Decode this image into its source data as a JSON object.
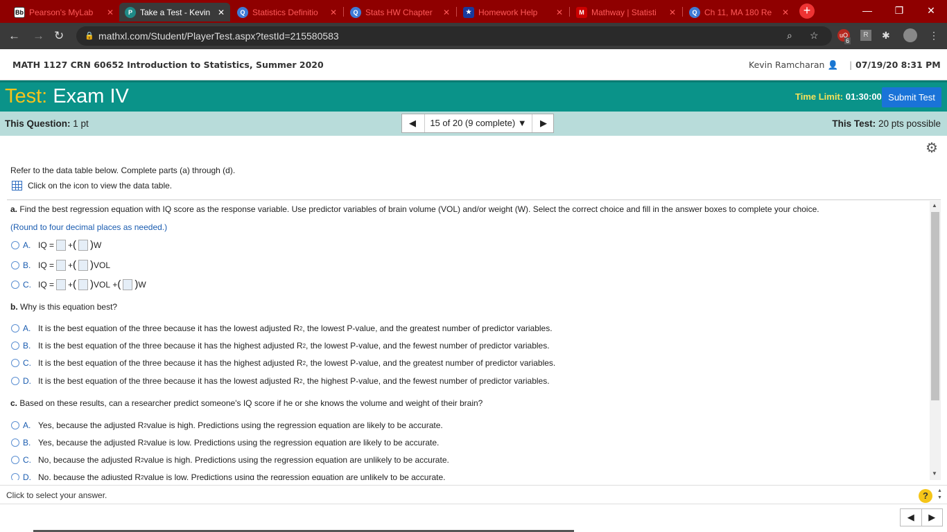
{
  "browser": {
    "tabs": [
      {
        "title": "Pearson's MyLab",
        "icon": "Bb",
        "active": false
      },
      {
        "title": "Take a Test - Kevin",
        "icon": "P",
        "active": true
      },
      {
        "title": "Statistics Definitio",
        "icon": "Q",
        "active": false
      },
      {
        "title": "Stats HW Chapter",
        "icon": "Q",
        "active": false
      },
      {
        "title": "Homework Help",
        "icon": "★",
        "active": false
      },
      {
        "title": "Mathway | Statisti",
        "icon": "M",
        "active": false
      },
      {
        "title": "Ch 11, MA 180 Re",
        "icon": "Q",
        "active": false
      }
    ],
    "url": "mathxl.com/Student/PlayerTest.aspx?testId=215580583",
    "ext_badge": "6"
  },
  "header": {
    "course": "MATH 1127 CRN 60652 Introduction to Statistics, Summer 2020",
    "user": "Kevin Ramcharan",
    "datetime": "07/19/20 8:31 PM"
  },
  "testbar": {
    "label": "Test:",
    "name": "Exam IV",
    "time_limit_label": "Time Limit:",
    "time_limit": "01:30:00",
    "submit": "Submit Test"
  },
  "qbar": {
    "question_label": "This Question:",
    "question_pts": "1 pt",
    "progress": "15 of 20 (9 complete)",
    "test_label": "This Test:",
    "test_pts": "20 pts possible"
  },
  "question": {
    "intro": "Refer to the data table below. Complete parts (a) through (d).",
    "table_link": "Click on the icon to view the data table.",
    "part_a_label": "a.",
    "part_a": "Find the best regression equation with IQ score as the response variable. Use predictor variables of brain volume (VOL) and/or weight (W). Select the correct choice and fill in the answer boxes to complete your choice.",
    "round_hint": "(Round to four decimal places as needed.)",
    "part_a_options": [
      {
        "letter": "A.",
        "lhs": "IQ =",
        "terms": [
          "W"
        ]
      },
      {
        "letter": "B.",
        "lhs": "IQ =",
        "terms": [
          "VOL"
        ]
      },
      {
        "letter": "C.",
        "lhs": "IQ =",
        "terms": [
          "VOL",
          "W"
        ]
      }
    ],
    "part_b_label": "b.",
    "part_b": "Why is this equation best?",
    "part_b_options": [
      {
        "letter": "A.",
        "pre": "It is the best equation of the three because it has the lowest adjusted R",
        "post": ", the lowest P-value, and the greatest number of predictor variables."
      },
      {
        "letter": "B.",
        "pre": "It is the best equation of the three because it has the highest adjusted R",
        "post": ", the lowest P-value, and the fewest number of predictor variables."
      },
      {
        "letter": "C.",
        "pre": "It is the best equation of the three because it has the highest adjusted R",
        "post": ", the lowest P-value, and the greatest number of predictor variables."
      },
      {
        "letter": "D.",
        "pre": "It is the best equation of the three because it has the lowest adjusted R",
        "post": ", the highest P-value, and the fewest number of predictor variables."
      }
    ],
    "part_c_label": "c.",
    "part_c": "Based on these results, can a researcher predict someone's IQ score if he or she knows the volume and weight of their brain?",
    "part_c_options": [
      {
        "letter": "A.",
        "pre": "Yes, because the adjusted R",
        "post": " value is high. Predictions using the regression equation are likely to be accurate."
      },
      {
        "letter": "B.",
        "pre": "Yes, because the adjusted R",
        "post": " value is low. Predictions using the regression equation are likely to be accurate."
      },
      {
        "letter": "C.",
        "pre": "No, because the adjusted R",
        "post": " value is high. Predictions using the regression equation are unlikely to be accurate."
      },
      {
        "letter": "D.",
        "pre": "No, because the adjusted R",
        "post": " value is low. Predictions using the regression equation are unlikely to be accurate."
      }
    ],
    "sup": "2",
    "plus": "+"
  },
  "footer": {
    "hint": "Click to select your answer.",
    "help": "?"
  }
}
